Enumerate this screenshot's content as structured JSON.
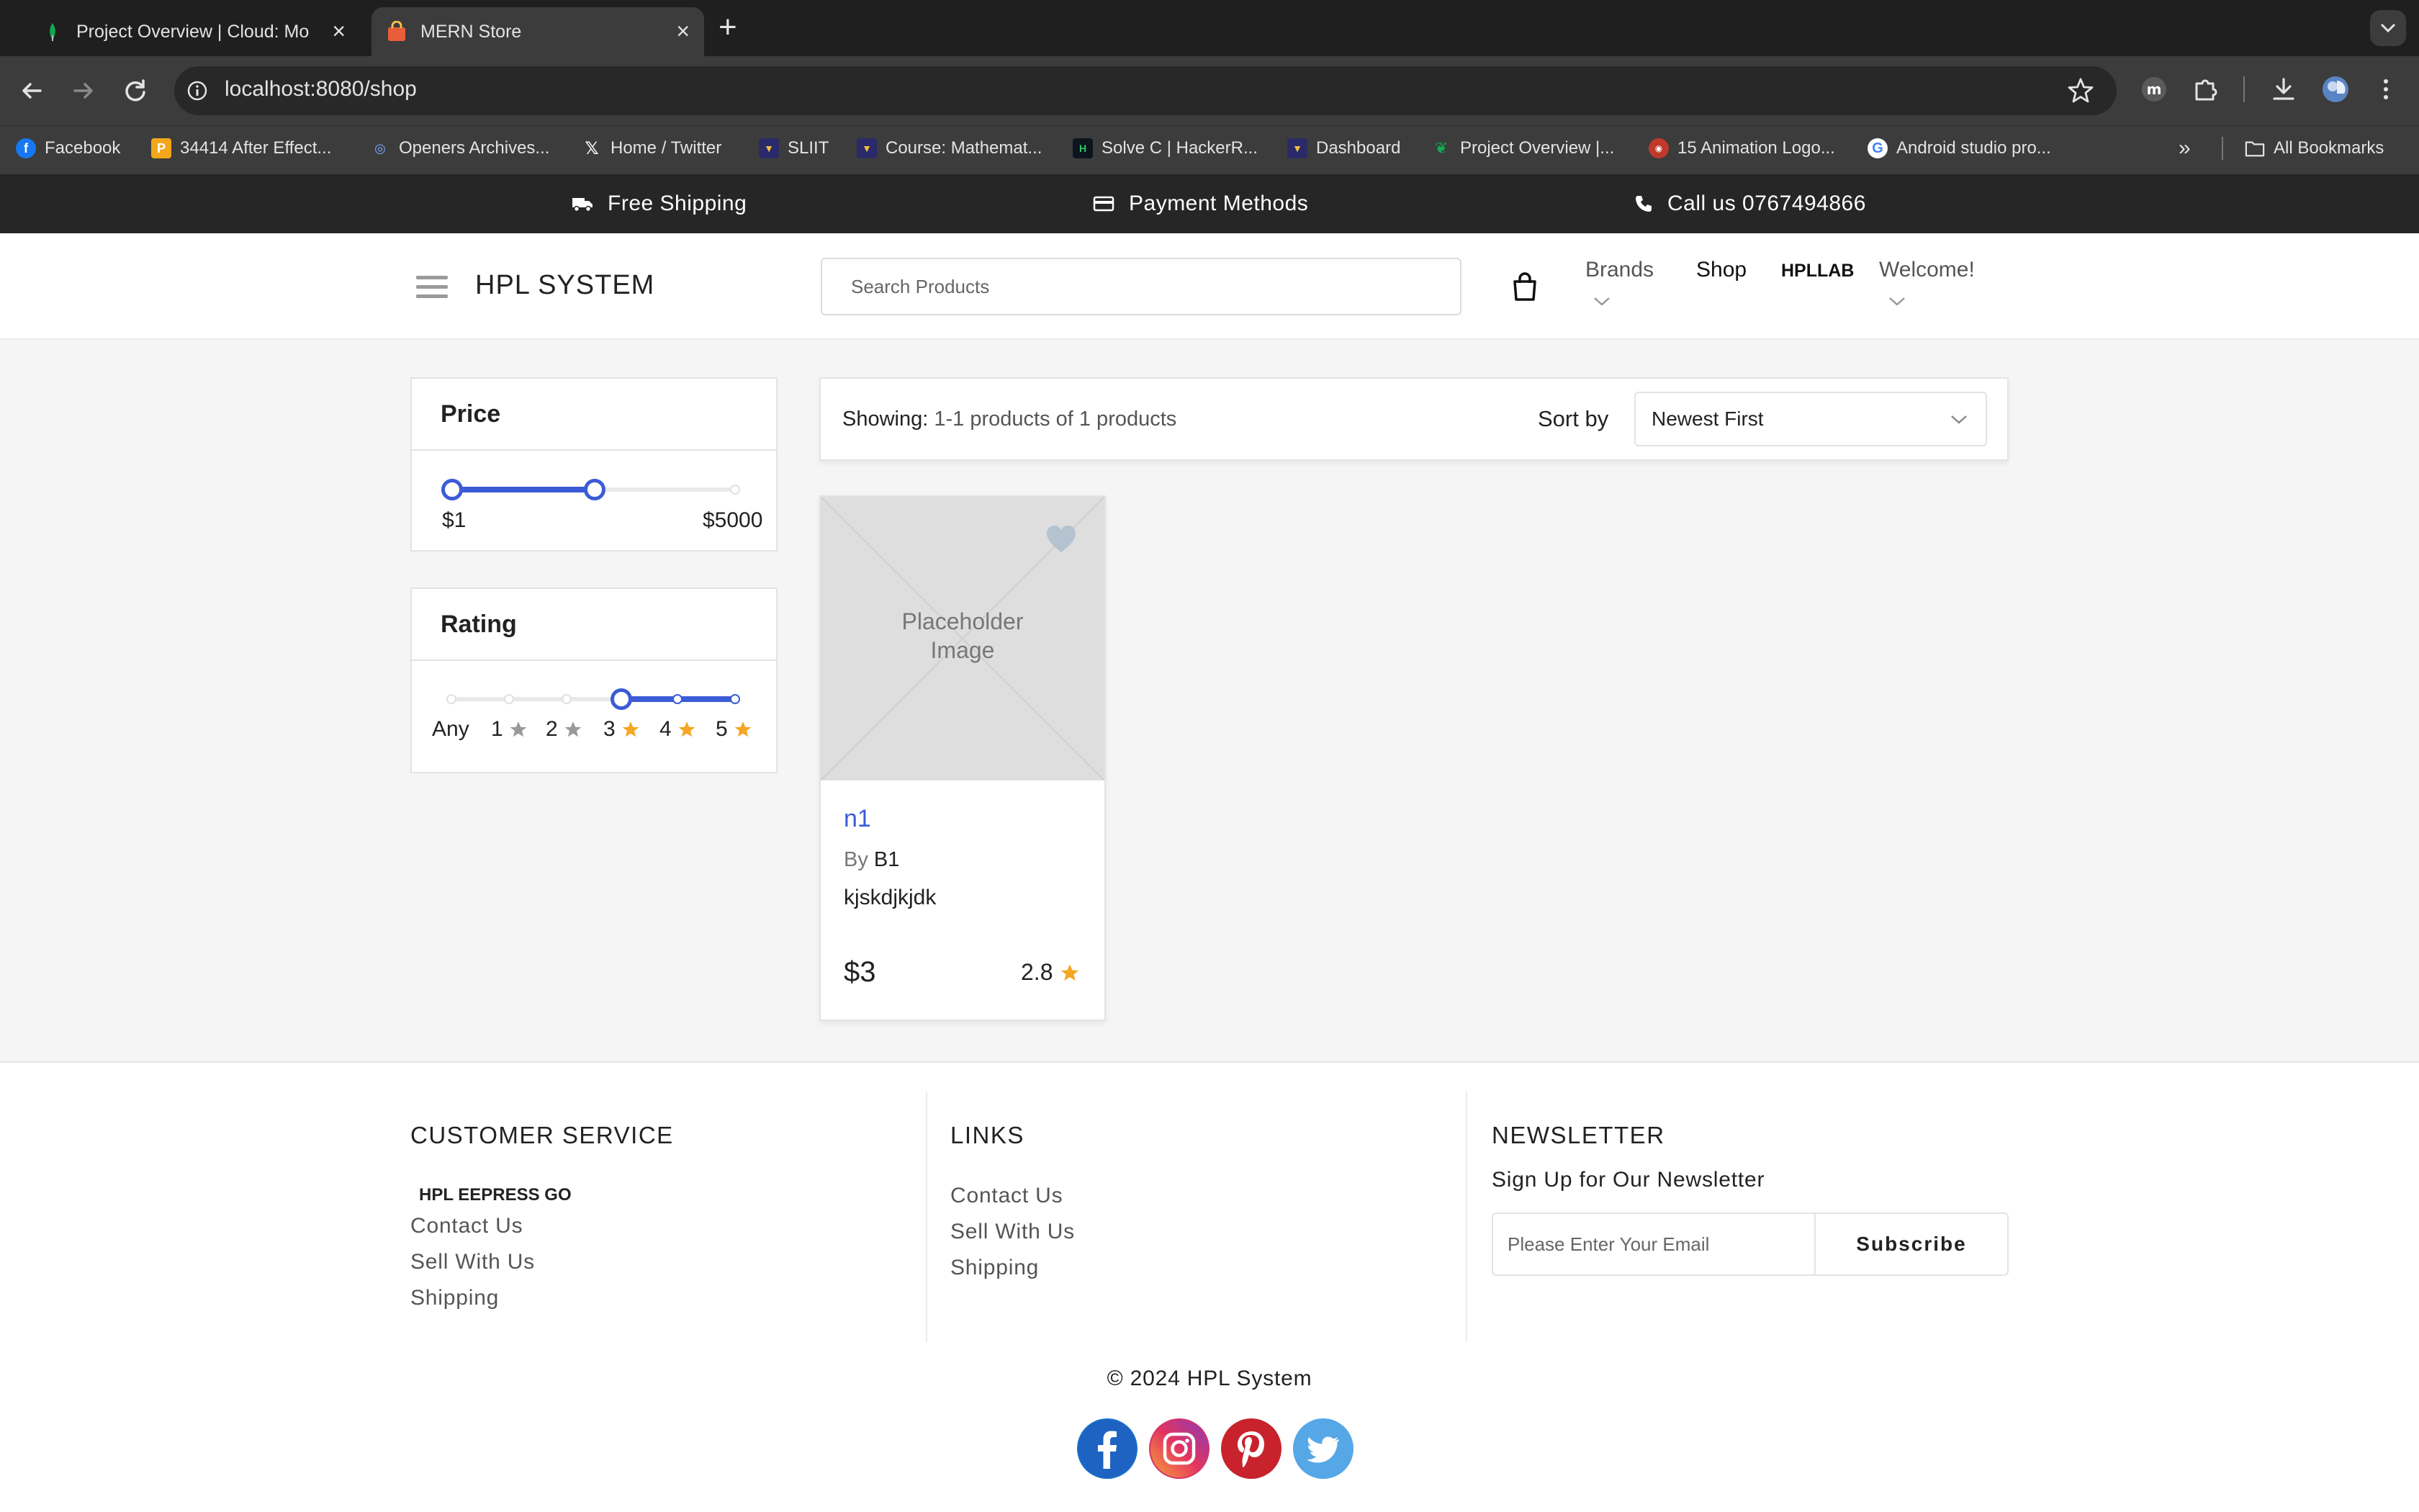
{
  "browser": {
    "tabs": [
      {
        "title": "Project Overview | Cloud: Mo",
        "active": false
      },
      {
        "title": "MERN Store",
        "active": true
      }
    ],
    "url": "localhost:8080/shop",
    "bookmarks": [
      {
        "label": "Facebook",
        "icon": "facebook-icon"
      },
      {
        "label": "34414 After Effect...",
        "icon": "p-icon"
      },
      {
        "label": "Openers Archives...",
        "icon": "openers-icon"
      },
      {
        "label": "Home / Twitter",
        "icon": "x-icon"
      },
      {
        "label": "SLIIT",
        "icon": "sliit-icon"
      },
      {
        "label": "Course: Mathemat...",
        "icon": "course-icon"
      },
      {
        "label": "Solve C | HackerR...",
        "icon": "hackerrank-icon"
      },
      {
        "label": "Dashboard",
        "icon": "dashboard-icon"
      },
      {
        "label": "Project Overview |...",
        "icon": "mongodb-icon"
      },
      {
        "label": "15 Animation Logo...",
        "icon": "animation-icon"
      },
      {
        "label": "Android studio pro...",
        "icon": "google-icon"
      }
    ],
    "all_bookmarks": "All Bookmarks"
  },
  "promo": {
    "shipping": "Free Shipping",
    "payment": "Payment Methods",
    "call": "Call us 0767494866"
  },
  "header": {
    "brand": "HPL SYSTEM",
    "search_placeholder": "Search Products",
    "nav": {
      "brands": "Brands",
      "shop": "Shop",
      "hpllab": "HPLLAB",
      "welcome": "Welcome!"
    }
  },
  "filters": {
    "price": {
      "title": "Price",
      "min_label": "$1",
      "max_label": "$5000",
      "range_min_fraction": 0.0,
      "range_max_fraction": 0.5
    },
    "rating": {
      "title": "Rating",
      "labels": [
        "Any",
        "1",
        "2",
        "3",
        "4",
        "5"
      ],
      "selected_from": 3
    }
  },
  "results": {
    "showing_label": "Showing:",
    "showing_text": "1-1 products of 1 products",
    "sort_label": "Sort by",
    "sort_value": "Newest First"
  },
  "product": {
    "image_text_1": "Placeholder",
    "image_text_2": "Image",
    "name": "n1",
    "by_label": "By",
    "brand": "B1",
    "description": "kjskdjkjdk",
    "price": "$3",
    "rating": "2.8"
  },
  "footer": {
    "customer_service": {
      "title": "CUSTOMER SERVICE",
      "sub": "HPL EEPRESS GO",
      "links": [
        "Contact Us",
        "Sell With Us",
        "Shipping"
      ]
    },
    "links": {
      "title": "LINKS",
      "links": [
        "Contact Us",
        "Sell With Us",
        "Shipping"
      ]
    },
    "newsletter": {
      "title": "NEWSLETTER",
      "subtitle": "Sign Up for Our Newsletter",
      "email_placeholder": "Please Enter Your Email",
      "button": "Subscribe"
    },
    "copyright": "© 2024 HPL System",
    "social": [
      "facebook-icon",
      "instagram-icon",
      "pinterest-icon",
      "twitter-icon"
    ]
  },
  "colors": {
    "accent": "#3b5bd7",
    "star": "#f5a623",
    "promo_bg": "#262626",
    "main_bg": "#f5f5f5"
  }
}
